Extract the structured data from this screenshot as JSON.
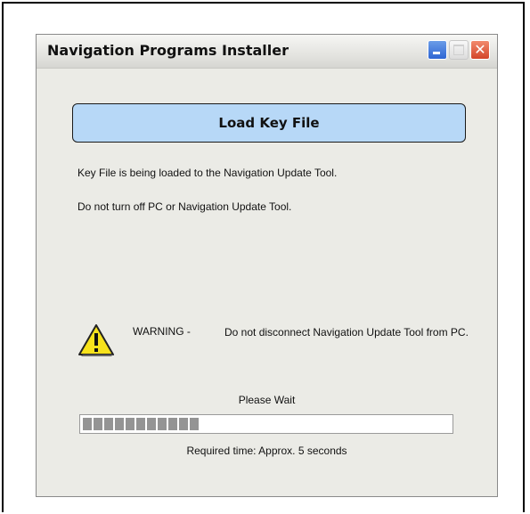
{
  "window": {
    "title": "Navigation Programs Installer",
    "close_glyph": "✕"
  },
  "banner": {
    "label": "Load Key File",
    "color": "#b7d8f7"
  },
  "messages": [
    "Key File is being loaded to the Navigation Update Tool.",
    "Do not turn off PC or Navigation Update Tool."
  ],
  "warning": {
    "icon": "warning-icon",
    "label": "WARNING -",
    "text": "Do not disconnect Navigation Update Tool from PC."
  },
  "status": {
    "please_wait": "Please Wait",
    "progress_fraction": 0.31,
    "required_time": "Required time: Approx. 5 seconds"
  }
}
